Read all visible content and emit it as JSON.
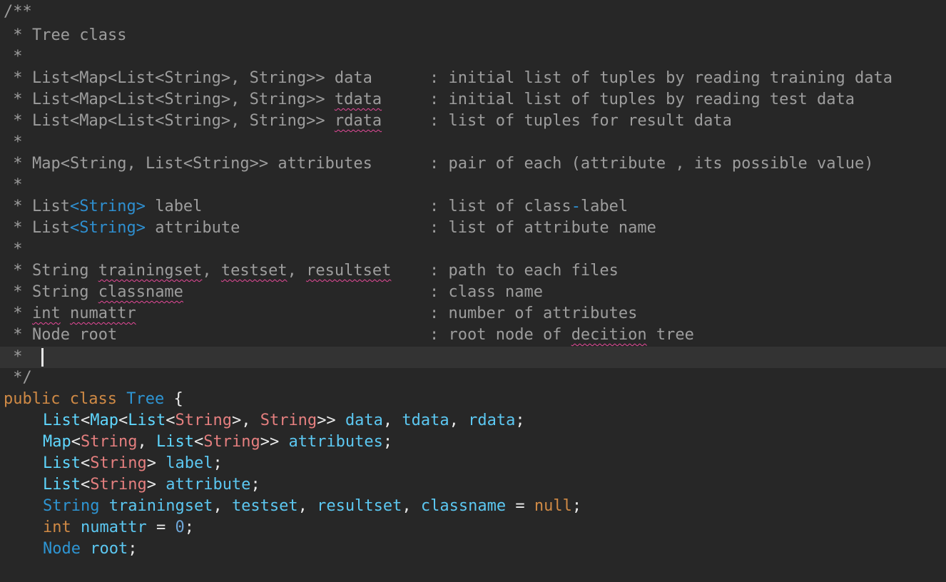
{
  "comment": {
    "open": "/**",
    "star": " *",
    "close": " */",
    "title": "Tree class",
    "rows": [
      {
        "decl": "List<Map<List<String>, String>> data",
        "desc": ": initial list of tuples by reading training data"
      },
      {
        "decl_prefix": "List<Map<List<String>, String>> ",
        "decl_spell": "tdata",
        "desc": ": initial list of tuples by reading test data"
      },
      {
        "decl_prefix": "List<Map<List<String>, String>> ",
        "decl_spell": "rdata",
        "desc": ": list of tuples for result data"
      },
      {
        "decl": "Map<String, List<String>> attributes",
        "desc": ": pair of each (attribute , its possible value)"
      },
      {
        "decl_prefix": "List",
        "decl_type": "<String>",
        "decl_suffix": " label",
        "desc_prefix": ": list of class",
        "desc_dash": "-",
        "desc_suffix": "label"
      },
      {
        "decl_prefix": "List",
        "decl_type": "<String>",
        "decl_suffix": " attribute",
        "desc": ": list of attribute name"
      },
      {
        "decl_a": "String ",
        "decl_b": "trainingset",
        "decl_c": ", ",
        "decl_d": "testset",
        "decl_e": ", ",
        "decl_f": "resultset",
        "desc": ": path to each files"
      },
      {
        "decl_a": "String ",
        "decl_b": "classname",
        "desc": ": class name"
      },
      {
        "decl_b": "int",
        "decl_c": " ",
        "decl_d": "numattr",
        "desc": ": number of attributes"
      },
      {
        "decl": "Node root",
        "desc_prefix": ": root node of ",
        "desc_spell": "decition",
        "desc_suffix": " tree"
      }
    ]
  },
  "code": {
    "kw_public": "public",
    "kw_class": "class",
    "class_name": "Tree",
    "brace_open": "{",
    "list": "List",
    "map": "Map",
    "string": "String",
    "lt": "<",
    "gt": ">",
    "gtgt": ">>",
    "comma": ", ",
    "semi": ";",
    "v_data": "data",
    "v_tdata": "tdata",
    "v_rdata": "rdata",
    "v_attributes": "attributes",
    "v_label": "label",
    "v_attribute": "attribute",
    "v_trainingset": "trainingset",
    "v_testset": "testset",
    "v_resultset": "resultset",
    "v_classname": "classname",
    "eq": " = ",
    "null": "null",
    "kw_int": "int",
    "v_numattr": "numattr",
    "zero": "0",
    "node": "Node",
    "v_root": "root"
  },
  "colors": {
    "background": "#272727",
    "current_line": "#333333",
    "comment": "#9d9d9d",
    "keyword": "#d08a45",
    "type": "#2e95d3",
    "identifier": "#5fd7ff",
    "generic_string": "#e57f7f",
    "spellcheck": "#e8499a"
  }
}
